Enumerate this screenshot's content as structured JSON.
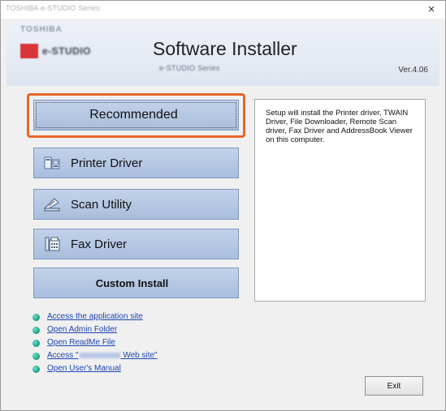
{
  "window": {
    "title": "TOSHIBA e-STUDIO Series",
    "close_glyph": "×"
  },
  "header": {
    "brand_line1": "TOSHIBA",
    "brand_line2": "e-STUDIO",
    "title": "Software Installer",
    "subtitle": "e-STUDIO Series",
    "version": "Ver.4.06"
  },
  "buttons": {
    "recommended": "Recommended",
    "printer_driver": "Printer Driver",
    "scan_utility": "Scan Utility",
    "fax_driver": "Fax Driver",
    "custom_install": "Custom Install"
  },
  "icons": {
    "printer": "printer-driver-icon",
    "scan": "scan-utility-icon",
    "fax": "fax-driver-icon"
  },
  "description": "Setup will install the Printer driver, TWAIN Driver, File Downloader, Remote Scan driver, Fax Driver and AddressBook Viewer on this computer.",
  "links": {
    "application_site": "Access the application site",
    "admin_folder": "Open Admin Folder",
    "readme": "Open ReadMe File",
    "web_site_prefix": "Access \"",
    "web_site_suffix": " Web site\"",
    "users_manual": "Open User's Manual"
  },
  "exit_label": "Exit",
  "colors": {
    "highlight": "#e7672a",
    "button_bg": "#b4c6e2",
    "link": "#1e44b3",
    "bullet": "#1ea58c"
  }
}
